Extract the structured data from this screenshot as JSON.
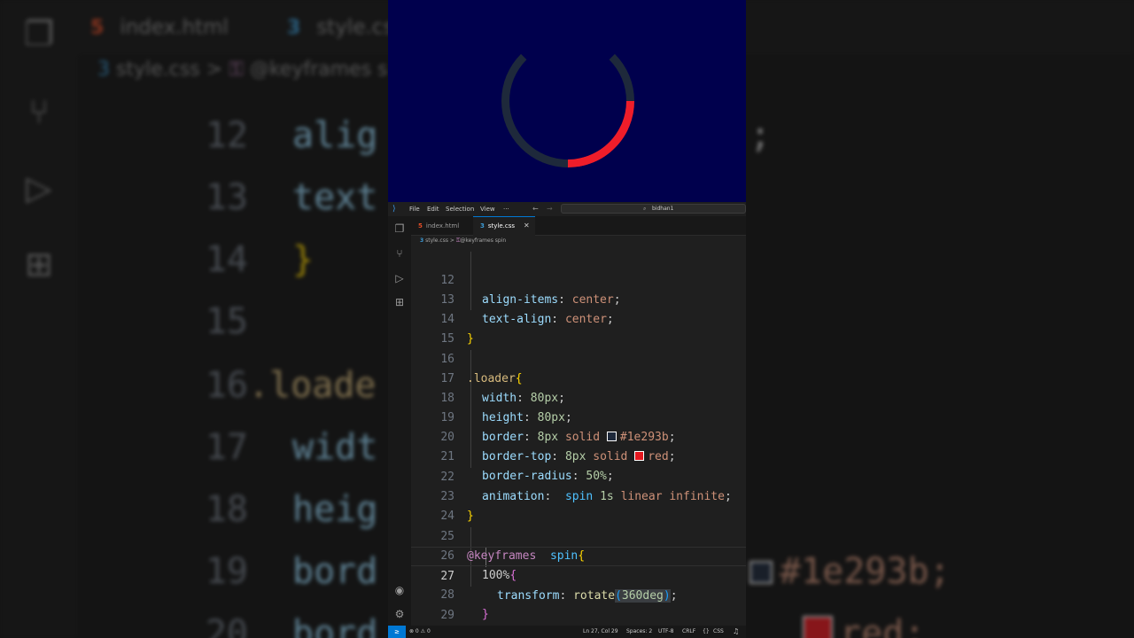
{
  "background": {
    "tabs": [
      "index.html",
      "style.css"
    ],
    "breadcrumb": [
      "style.css",
      ">",
      "@keyframes s"
    ],
    "line_numbers": [
      "12",
      "13",
      "14",
      "15",
      "16",
      "17",
      "18",
      "19",
      "20"
    ],
    "code": [
      "alig",
      "text",
      "}",
      "",
      ".loade",
      "widt",
      "heig",
      "bord",
      "bord"
    ],
    "right_code": [
      ";",
      "",
      "",
      "",
      "",
      "",
      "",
      "#1e293b;",
      "red;"
    ]
  },
  "preview": {
    "bg_color": "#00004d",
    "ring_color": "#1e293b",
    "spinner_color": "#ef1d2a"
  },
  "titlebar": {
    "menu": [
      "File",
      "Edit",
      "Selection",
      "View",
      "···"
    ],
    "search_text": "bidhan1"
  },
  "tabs": [
    {
      "label": "index.html",
      "icon": "html5-icon",
      "active": false
    },
    {
      "label": "style.css",
      "icon": "css3-icon",
      "active": true,
      "close": "✕"
    }
  ],
  "breadcrumb": {
    "file": "style.css",
    "separator": ">",
    "symbol": "@keyframes spin"
  },
  "editor": {
    "line_numbers": [
      "12",
      "13",
      "14",
      "15",
      "16",
      "17",
      "18",
      "19",
      "20",
      "21",
      "22",
      "23",
      "24",
      "25",
      "26",
      "27",
      "28",
      "29"
    ],
    "current_line": "27",
    "lines": {
      "l12": {
        "prop": "align-items",
        "value": "center"
      },
      "l13": {
        "prop": "text-align",
        "value": "center"
      },
      "l14": {
        "brace": "}"
      },
      "l16": {
        "selector": ".loader",
        "brace": "{"
      },
      "l17": {
        "prop": "width",
        "value": "80px"
      },
      "l18": {
        "prop": "height",
        "value": "80px"
      },
      "l19": {
        "prop": "border",
        "num": "8px",
        "kw": "solid",
        "color": "#1e293b",
        "swatch": "#1e293b"
      },
      "l20": {
        "prop": "border-top",
        "num": "8px",
        "kw": "solid",
        "color": "red",
        "swatch": "#e5181f"
      },
      "l21": {
        "prop": "border-radius",
        "value": "50%"
      },
      "l22": {
        "prop": "animation",
        "name": "spin",
        "num": "1s",
        "kw": "linear infinite"
      },
      "l23": {
        "brace": "}"
      },
      "l25": {
        "at": "@keyframes",
        "name": "spin",
        "brace": "{"
      },
      "l26": {
        "num": "100%",
        "brace": "{"
      },
      "l27": {
        "prop": "transform",
        "func": "rotate",
        "arg": "360deg"
      },
      "l28": {
        "brace": "}"
      },
      "l29": {
        "brace": "}"
      }
    }
  },
  "status": {
    "remote": "≥",
    "problems": "⊗ 0 ⚠ 0",
    "position": "Ln 27, Col 29",
    "spaces": "Spaces: 2",
    "encoding": "UTF-8",
    "eol": "CRLF",
    "language": "CSS"
  }
}
